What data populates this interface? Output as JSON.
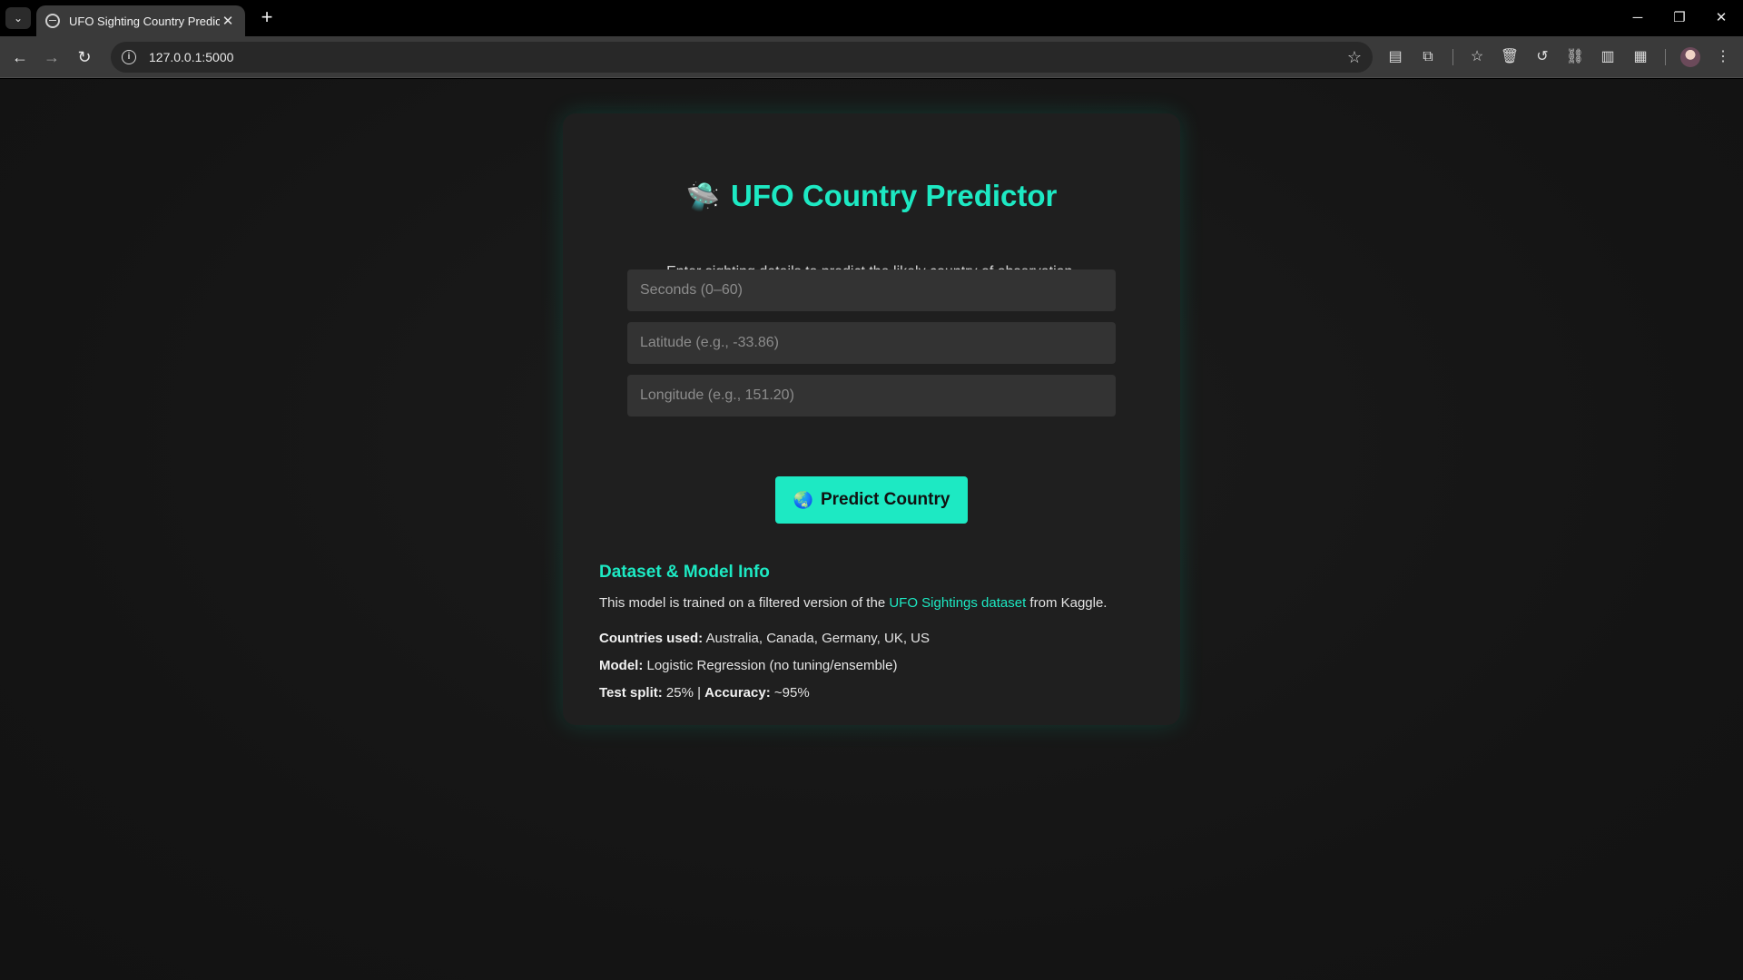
{
  "browser": {
    "tab_title": "UFO Sighting Country Predictor",
    "url": "127.0.0.1:5000"
  },
  "page": {
    "heading": "UFO Country Predictor",
    "heading_icon": "🛸",
    "subtitle": "Enter sighting details to predict the likely country of observation.",
    "fields": {
      "seconds_placeholder": "Seconds (0–60)",
      "latitude_placeholder": "Latitude (e.g., -33.86)",
      "longitude_placeholder": "Longitude (e.g., 151.20)"
    },
    "predict_button": {
      "icon": "🌏",
      "label": "Predict Country"
    },
    "info": {
      "title": "Dataset & Model Info",
      "intro_before": "This model is trained on a filtered version of the ",
      "dataset_link": "UFO Sightings dataset",
      "intro_after": " from Kaggle.",
      "countries_label": "Countries used:",
      "countries_value": " Australia, Canada, Germany, UK, US",
      "model_label": "Model:",
      "model_value": " Logistic Regression (no tuning/ensemble)",
      "split_label": "Test split:",
      "split_value": " 25% | ",
      "accuracy_label": "Accuracy:",
      "accuracy_value": " ~95%"
    }
  },
  "colors": {
    "accent": "#1de9c3",
    "card": "#1f1f1f",
    "background": "#141414"
  }
}
